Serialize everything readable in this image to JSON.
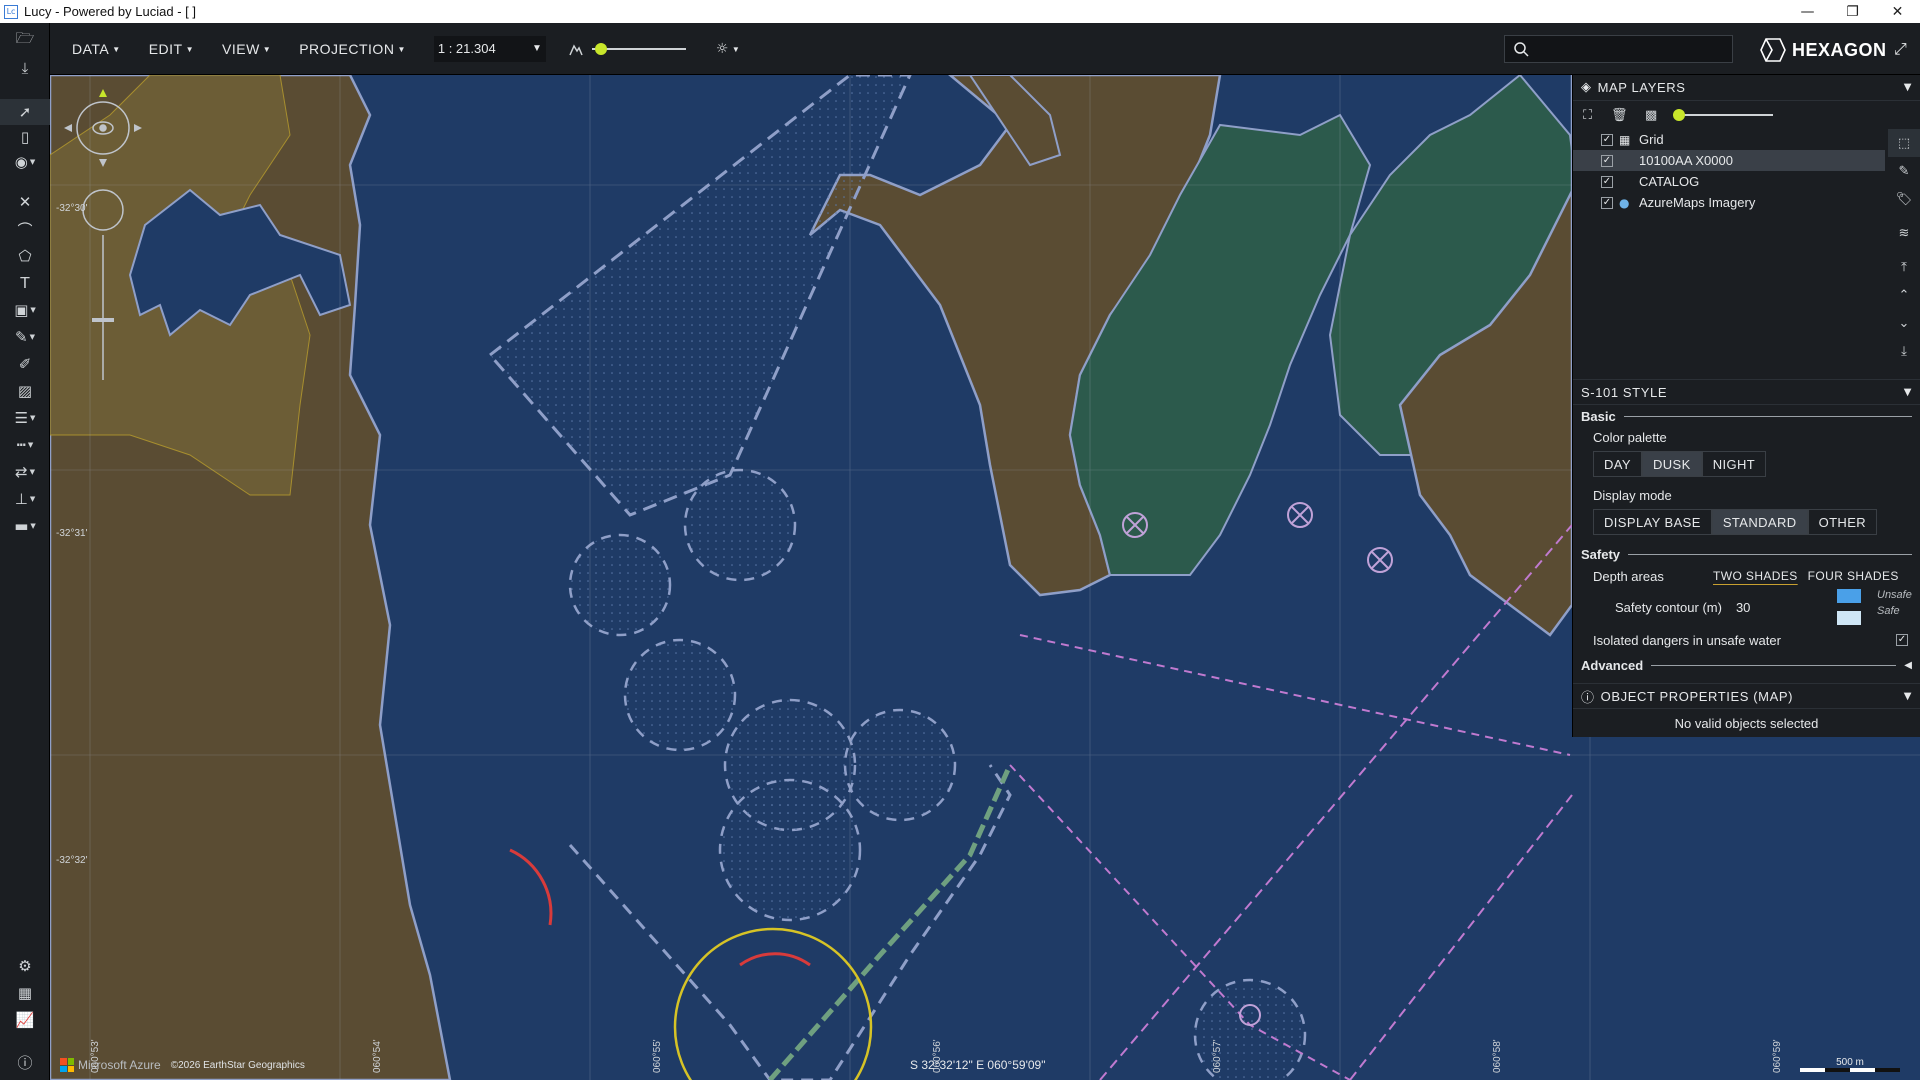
{
  "window": {
    "title": "Lucy - Powered by Luciad - [ ]",
    "app_icon": "Lc",
    "controls": [
      "minimize-icon",
      "maximize-icon",
      "close-icon"
    ]
  },
  "menubar": {
    "menus": [
      "DATA",
      "EDIT",
      "VIEW",
      "PROJECTION"
    ],
    "scale_value": "1 : 21.304",
    "zoom_level": 0.1,
    "search_placeholder": "",
    "brand": "HEXAGON"
  },
  "left_toolbar": {
    "tools": [
      "open-folder-icon",
      "download-icon",
      "select-pointer-icon",
      "bookmark-icon",
      "eye-icon",
      "close-icon",
      "lasso-icon",
      "polygon-icon",
      "text-icon",
      "shapes-icon",
      "ruler-icon",
      "pencil-icon",
      "image-icon",
      "lines-icon",
      "dashed-lines-icon",
      "swap-icon",
      "pin-icon",
      "paint-roller-icon",
      "globe-settings-icon",
      "table-icon",
      "chart-icon",
      "info-icon"
    ]
  },
  "map": {
    "lat_labels": [
      "-32°30'",
      "-32°31'",
      "-32°32'"
    ],
    "lon_labels": [
      "060°53'",
      "060°54'",
      "060°55'",
      "060°56'",
      "060°57'",
      "060°58'",
      "060°59'"
    ],
    "attribution_brand": "Microsoft Azure",
    "attribution": "©2026 EarthStar Geographics",
    "cursor_coordinates": "S 32°32'12\" E 060°59'09\"",
    "scalebar_label": "500 m",
    "colors": {
      "deep_water": "#1f3b66",
      "land": "#5a4c33",
      "land_yellow": "#7a6a3a",
      "intertidal": "#2c5a4c",
      "coast": "#8f9fc8",
      "route": "#c07ad0"
    }
  },
  "map_layers": {
    "title": "MAP LAYERS",
    "layers": [
      {
        "name": "Grid",
        "checked": true,
        "icon": "grid-icon",
        "selected": false
      },
      {
        "name": "10100AA X0000",
        "checked": true,
        "icon": "",
        "selected": true
      },
      {
        "name": "CATALOG",
        "checked": true,
        "icon": "",
        "selected": false
      },
      {
        "name": "AzureMaps Imagery",
        "checked": true,
        "icon": "globe-icon",
        "selected": false
      }
    ],
    "opacity": 0.0
  },
  "s101_style": {
    "title": "S-101 STYLE",
    "basic_label": "Basic",
    "color_palette_label": "Color palette",
    "palette_options": [
      "DAY",
      "DUSK",
      "NIGHT"
    ],
    "palette_selected": "DUSK",
    "display_mode_label": "Display mode",
    "display_options": [
      "DISPLAY BASE",
      "STANDARD",
      "OTHER"
    ],
    "display_selected": "STANDARD",
    "safety_label": "Safety",
    "depth_areas_label": "Depth areas",
    "depth_options": [
      "TWO SHADES",
      "FOUR SHADES"
    ],
    "depth_selected": "TWO SHADES",
    "safety_contour_label": "Safety contour (m)",
    "safety_contour_value": "30",
    "unsafe_label": "Unsafe",
    "safe_label": "Safe",
    "isolated_dangers_label": "Isolated dangers in unsafe water",
    "isolated_dangers_checked": true,
    "advanced_label": "Advanced"
  },
  "object_properties": {
    "title": "OBJECT PROPERTIES (MAP)",
    "message": "No valid objects selected"
  }
}
